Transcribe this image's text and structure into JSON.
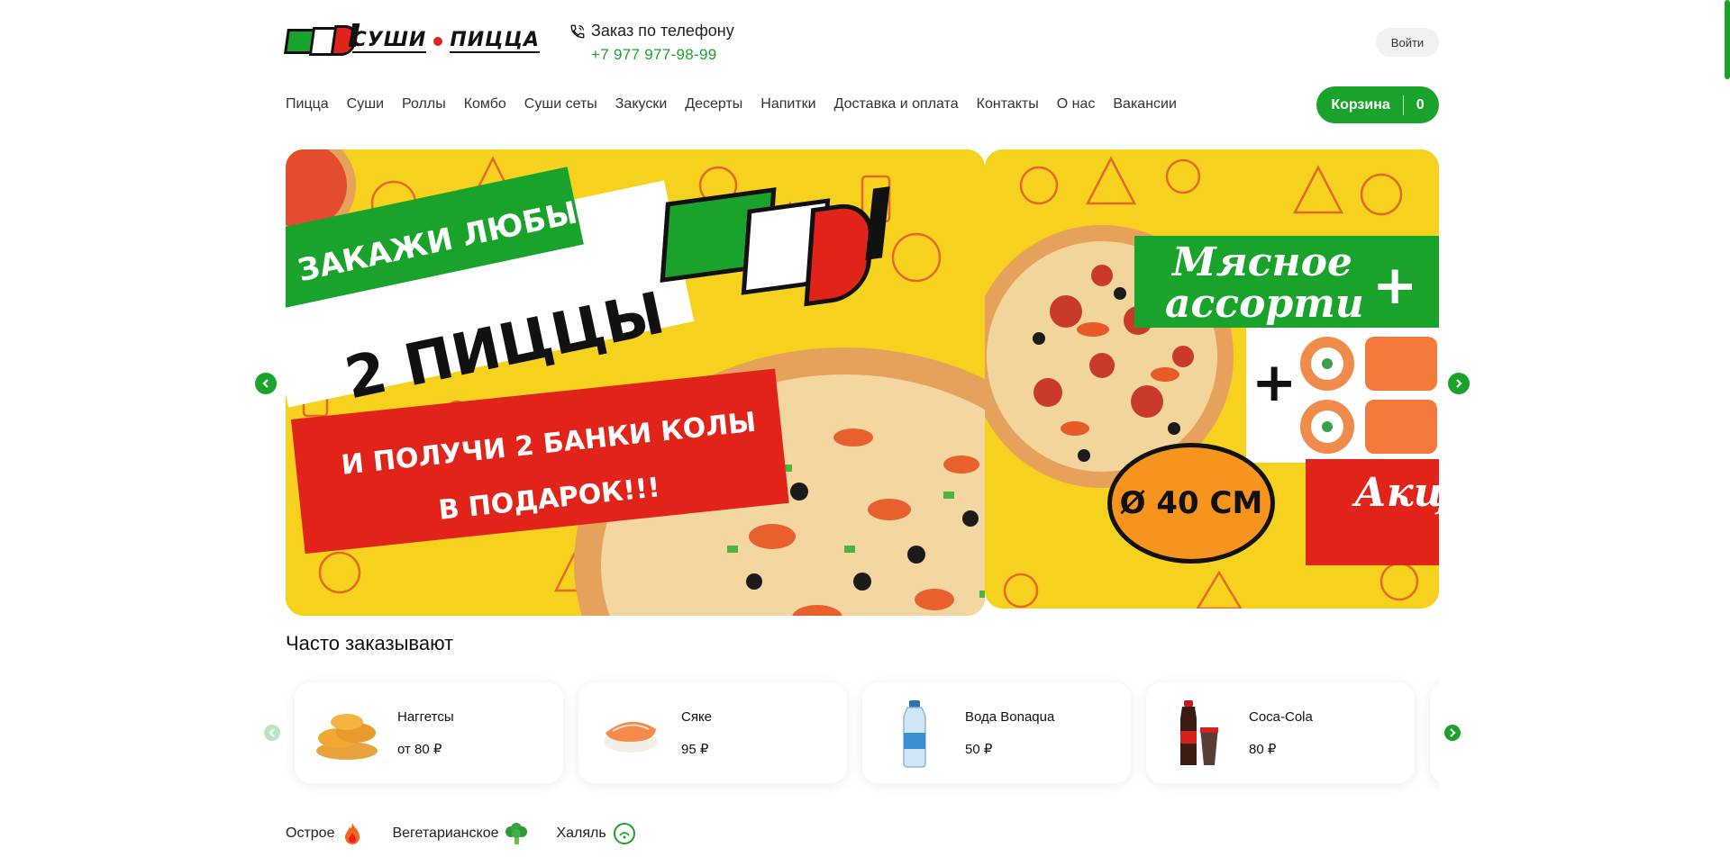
{
  "brand": {
    "logo_text": "ЕШЬ!",
    "tagline_1": "СУШИ",
    "tagline_2": "ПИЦЦА"
  },
  "contact": {
    "label": "Заказ по телефону",
    "phone": "+7 977 977-98-99"
  },
  "header": {
    "login_label": "Войти"
  },
  "nav": {
    "items": [
      {
        "label": "Пицца"
      },
      {
        "label": "Суши"
      },
      {
        "label": "Роллы"
      },
      {
        "label": "Комбо"
      },
      {
        "label": "Суши сеты"
      },
      {
        "label": "Закуски"
      },
      {
        "label": "Десерты"
      },
      {
        "label": "Напитки"
      },
      {
        "label": "Доставка и оплата"
      },
      {
        "label": "Контакты"
      },
      {
        "label": "О нас"
      },
      {
        "label": "Вакансии"
      }
    ]
  },
  "cart": {
    "label": "Корзина",
    "count": "0"
  },
  "slider": {
    "slides": [
      {
        "line1": "ЗАКАЖИ ЛЮБЫЕ",
        "line2": "2 ПИЦЦЫ",
        "line3": "И ПОЛУЧИ 2 БАНКИ КОЛЫ",
        "line4": "В ПОДАРОК!!!",
        "logo": "ЕШЬ!"
      },
      {
        "line1": "Мясное",
        "line2": "ассорти",
        "badge": "Ø 40 СМ",
        "tag": "Акц"
      }
    ]
  },
  "popular": {
    "title": "Часто заказывают",
    "items": [
      {
        "name": "Наггетсы",
        "price": "от 80 ₽"
      },
      {
        "name": "Сяке",
        "price": "95 ₽"
      },
      {
        "name": "Вода Bonaqua",
        "price": "50 ₽"
      },
      {
        "name": "Coca-Cola",
        "price": "80 ₽"
      }
    ]
  },
  "filters": {
    "items": [
      {
        "label": "Острое",
        "icon": "flame-icon"
      },
      {
        "label": "Вегетарианское",
        "icon": "broccoli-icon"
      },
      {
        "label": "Халяль",
        "icon": "halal-icon"
      }
    ]
  },
  "colors": {
    "accent": "#1aa32a",
    "red": "#e2231a",
    "yellow": "#f6d21e"
  }
}
